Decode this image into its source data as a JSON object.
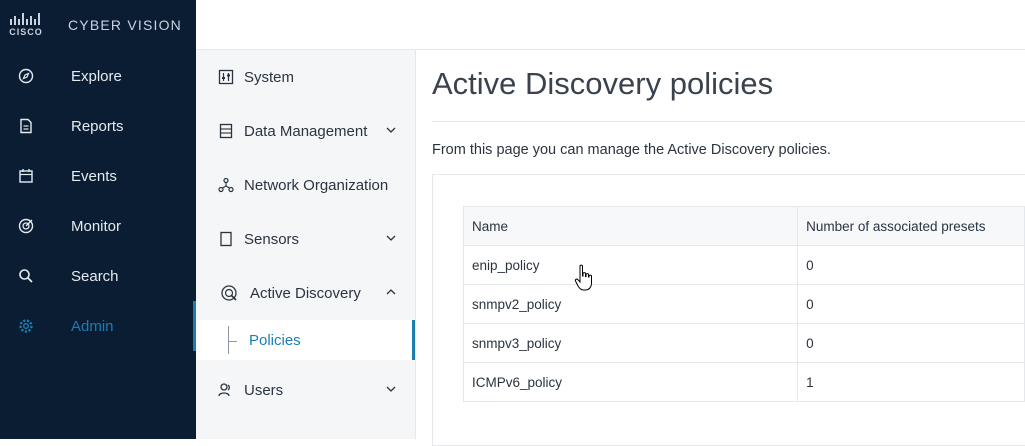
{
  "brand": {
    "name": "CYBER VISION",
    "logo_text": "CISCO"
  },
  "nav": [
    {
      "label": "Explore",
      "icon": "compass-icon"
    },
    {
      "label": "Reports",
      "icon": "document-icon"
    },
    {
      "label": "Events",
      "icon": "calendar-icon"
    },
    {
      "label": "Monitor",
      "icon": "target-icon"
    },
    {
      "label": "Search",
      "icon": "search-icon"
    },
    {
      "label": "Admin",
      "icon": "gear-icon",
      "active": true
    }
  ],
  "admin_menu": [
    {
      "label": "System",
      "icon": "sliders-icon"
    },
    {
      "label": "Data Management",
      "icon": "database-icon",
      "expandable": true
    },
    {
      "label": "Network Organization",
      "icon": "network-icon"
    },
    {
      "label": "Sensors",
      "icon": "sensor-icon",
      "expandable": true
    },
    {
      "label": "Active Discovery",
      "icon": "radar-icon",
      "expanded": true
    },
    {
      "label": "Policies",
      "active": true
    },
    {
      "label": "Users",
      "icon": "users-icon",
      "expandable": true
    }
  ],
  "page": {
    "title": "Active Discovery policies",
    "description": "From this page you can manage the Active Discovery policies."
  },
  "table": {
    "columns": [
      "Name",
      "Number of associated presets"
    ],
    "rows": [
      [
        "enip_policy",
        "0"
      ],
      [
        "snmpv2_policy",
        "0"
      ],
      [
        "snmpv3_policy",
        "0"
      ],
      [
        "ICMPv6_policy",
        "1"
      ]
    ]
  },
  "colors": {
    "nav_bg": "#0b1d33",
    "accent": "#1b7eb0"
  }
}
